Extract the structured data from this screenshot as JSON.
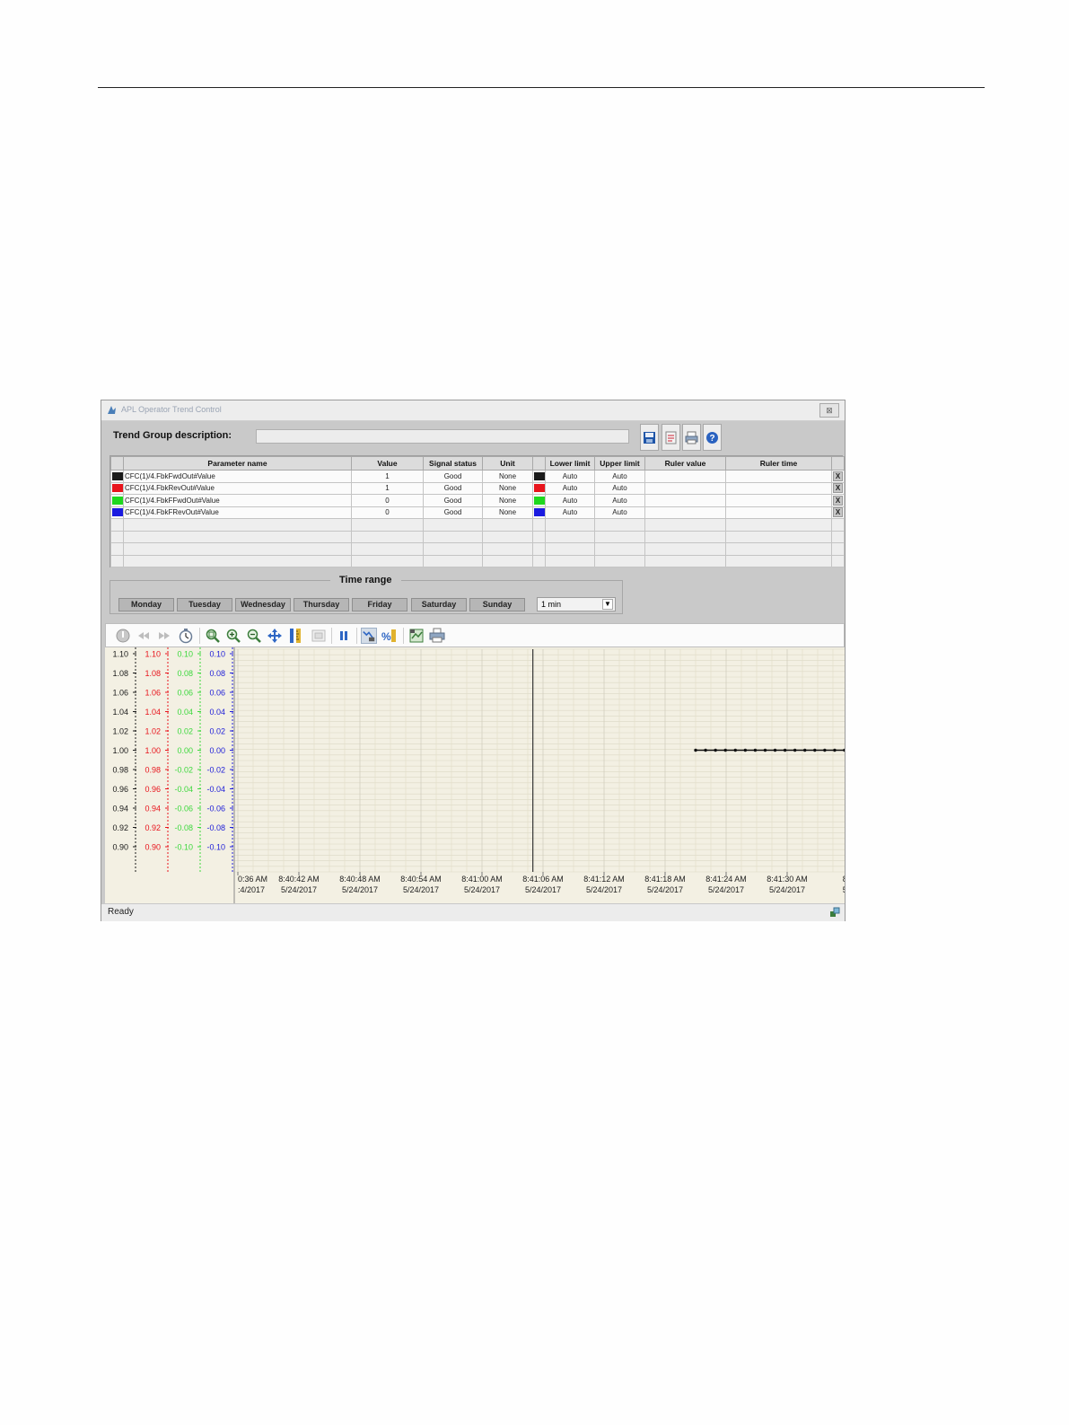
{
  "window": {
    "title": "APL Operator Trend Control"
  },
  "header": {
    "group_label": "Trend Group description:",
    "group_value": "",
    "buttons": [
      {
        "icon": "save-icon"
      },
      {
        "icon": "load-icon"
      },
      {
        "icon": "print-icon"
      },
      {
        "icon": "help-icon"
      }
    ]
  },
  "table": {
    "columns": [
      "",
      "Parameter name",
      "Value",
      "Signal status",
      "Unit",
      "",
      "Lower limit",
      "Upper limit",
      "Ruler value",
      "Ruler time",
      ""
    ],
    "rows": [
      {
        "color": "#1a1a1a",
        "name": "CFC(1)/4.FbkFwdOut#Value",
        "value": "1",
        "status": "Good",
        "unit": "None",
        "lower": "Auto",
        "upper": "Auto",
        "ruler_value": "",
        "ruler_time": "",
        "remove": "X"
      },
      {
        "color": "#e8141c",
        "name": "CFC(1)/4.FbkRevOut#Value",
        "value": "1",
        "status": "Good",
        "unit": "None",
        "lower": "Auto",
        "upper": "Auto",
        "ruler_value": "",
        "ruler_time": "",
        "remove": "X"
      },
      {
        "color": "#1ed81e",
        "name": "CFC(1)/4.FbkFFwdOut#Value",
        "value": "0",
        "status": "Good",
        "unit": "None",
        "lower": "Auto",
        "upper": "Auto",
        "ruler_value": "",
        "ruler_time": "",
        "remove": "X"
      },
      {
        "color": "#1a1ae0",
        "name": "CFC(1)/4.FbkFRevOut#Value",
        "value": "0",
        "status": "Good",
        "unit": "None",
        "lower": "Auto",
        "upper": "Auto",
        "ruler_value": "",
        "ruler_time": "",
        "remove": "X"
      }
    ],
    "empty_rows": 4
  },
  "time_range": {
    "label": "Time range",
    "days": [
      "Monday",
      "Tuesday",
      "Wednesday",
      "Thursday",
      "Friday",
      "Saturday",
      "Sunday"
    ],
    "selected": "1 min"
  },
  "toolbar": {
    "icons": [
      "start-stop-icon",
      "scroll-back-icon",
      "scroll-forward-icon",
      "timer-icon",
      "zoom-area-icon",
      "zoom-in-icon",
      "zoom-out-icon",
      "move-icon",
      "ruler-icon",
      "original-view-icon",
      "pause-icon",
      "online-trend-icon",
      "percent-icon",
      "export-icon",
      "print-trend-icon"
    ]
  },
  "chart_data": {
    "type": "line",
    "axes": [
      {
        "color": "#1a1a1a",
        "ticks": [
          "1.10",
          "1.08",
          "1.06",
          "1.04",
          "1.02",
          "1.00",
          "0.98",
          "0.96",
          "0.94",
          "0.92",
          "0.90"
        ],
        "ylim": [
          0.9,
          1.1
        ]
      },
      {
        "color": "#e8141c",
        "ticks": [
          "1.10",
          "1.08",
          "1.06",
          "1.04",
          "1.02",
          "1.00",
          "0.98",
          "0.96",
          "0.94",
          "0.92",
          "0.90"
        ],
        "ylim": [
          0.9,
          1.1
        ]
      },
      {
        "color": "#3cd83c",
        "ticks": [
          "0.10",
          "0.08",
          "0.06",
          "0.04",
          "0.02",
          "0.00",
          "-0.02",
          "-0.04",
          "-0.06",
          "-0.08",
          "-0.10"
        ],
        "ylim": [
          -0.1,
          0.1
        ]
      },
      {
        "color": "#2020d8",
        "ticks": [
          "0.10",
          "0.08",
          "0.06",
          "0.04",
          "0.02",
          "0.00",
          "-0.02",
          "-0.04",
          "-0.06",
          "-0.08",
          "-0.10"
        ],
        "ylim": [
          -0.1,
          0.1
        ]
      }
    ],
    "x_ticks": [
      {
        "time": "0:36 AM",
        "date": ":4/2017"
      },
      {
        "time": "8:40:42 AM",
        "date": "5/24/2017"
      },
      {
        "time": "8:40:48 AM",
        "date": "5/24/2017"
      },
      {
        "time": "8:40:54 AM",
        "date": "5/24/2017"
      },
      {
        "time": "8:41:00 AM",
        "date": "5/24/2017"
      },
      {
        "time": "8:41:06 AM",
        "date": "5/24/2017"
      },
      {
        "time": "8:41:12 AM",
        "date": "5/24/2017"
      },
      {
        "time": "8:41:18 AM",
        "date": "5/24/2017"
      },
      {
        "time": "8:41:24 AM",
        "date": "5/24/2017"
      },
      {
        "time": "8:41:30 AM",
        "date": "5/24/2017"
      },
      {
        "time": "8:4",
        "date": "5/2"
      }
    ],
    "ruler_time": "8:41:05 AM",
    "series": [
      {
        "color": "#111111",
        "y": 1.0,
        "x_start": "8:41:21 AM",
        "x_end": "8:41:36 AM",
        "points": 16
      }
    ],
    "grid": true,
    "background": "#f3f0e3"
  },
  "status": {
    "text": "Ready",
    "icon": "network-status-icon"
  }
}
